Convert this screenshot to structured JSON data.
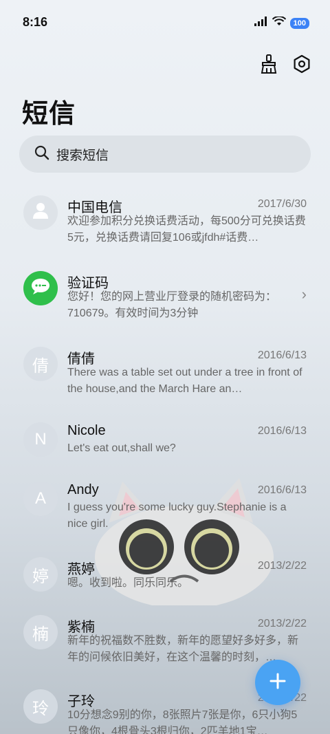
{
  "status_bar": {
    "time": "8:16",
    "battery": "100"
  },
  "header": {
    "title": "短信"
  },
  "search": {
    "placeholder": "搜索短信"
  },
  "messages": [
    {
      "name": "中国电信",
      "date": "2017/6/30",
      "snippet": "欢迎参加积分兑换话费活动，每500分可兑换话费5元，兑换话费请回复106或jfdh#话费…",
      "avatar": "person-icon"
    },
    {
      "name": "验证码",
      "date": "",
      "snippet": "您好！您的网上营业厅登录的随机密码为：710679。有效时间为3分钟",
      "avatar": "chat-bubble-icon"
    },
    {
      "name": "倩倩",
      "date": "2016/6/13",
      "snippet": "There was a table set out under a tree in front of the house,and the March Hare an…",
      "avatar_text": "倩"
    },
    {
      "name": "Nicole",
      "date": "2016/6/13",
      "snippet": "Let's eat out,shall we?",
      "avatar_text": "N"
    },
    {
      "name": "Andy",
      "date": "2016/6/13",
      "snippet": "I guess you're some lucky guy.Stephanie is a nice girl.",
      "avatar_text": "A"
    },
    {
      "name": "燕婷",
      "date": "2013/2/22",
      "snippet": "嗯。收到啦。同乐同乐。",
      "avatar_text": "婷"
    },
    {
      "name": "紫楠",
      "date": "2013/2/22",
      "snippet": "新年的祝福数不胜数，新年的愿望好多好多，新年的问候依旧美好，在这个温馨的时刻，…",
      "avatar_text": "楠"
    },
    {
      "name": "子玲",
      "date": "2013/2/22",
      "snippet": "10分想念9别的你，8张照片7张是你，6只小狗5只像你，4根骨头3根归你，2匹羊地1宝…",
      "avatar_text": "玲"
    }
  ],
  "colors": {
    "accent": "#4aa3f3",
    "green": "#2fbf4b"
  }
}
